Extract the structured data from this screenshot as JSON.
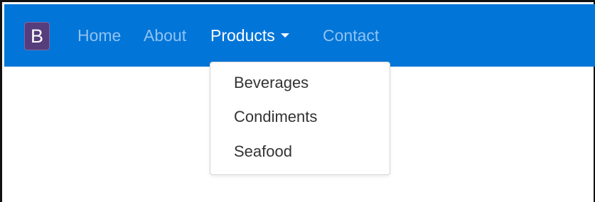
{
  "navbar": {
    "brand_label": "B",
    "links": [
      {
        "label": "Home"
      },
      {
        "label": "About"
      },
      {
        "label": "Products"
      },
      {
        "label": "Contact"
      }
    ],
    "colors": {
      "background": "#0275d8",
      "brand_background": "#563d7c",
      "inactive_link": "#8fc3f3",
      "active_link": "#ffffff"
    }
  },
  "dropdown": {
    "items": [
      {
        "label": "Beverages"
      },
      {
        "label": "Condiments"
      },
      {
        "label": "Seafood"
      }
    ]
  }
}
